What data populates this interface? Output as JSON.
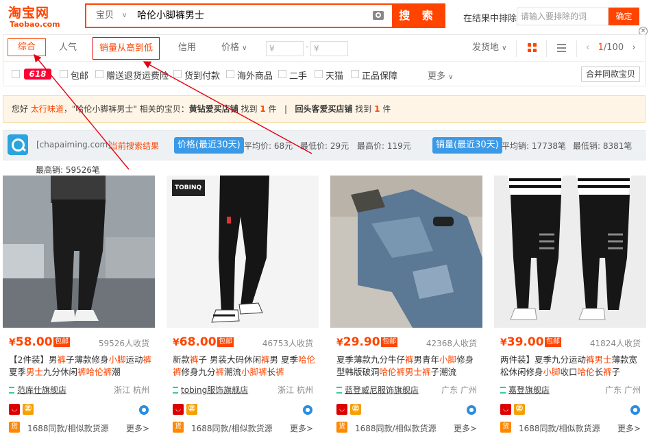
{
  "header": {
    "logo_line1": "淘宝网",
    "logo_line2": "Taobao.com",
    "search_type": "宝贝",
    "search_query": "哈伦小脚裤男士",
    "search_button": "搜 索",
    "exclude_label": "在结果中排除",
    "exclude_placeholder": "请输入要排除的词",
    "exclude_confirm": "确定"
  },
  "sortbar": {
    "items": [
      "综合",
      "人气",
      "销量从高到低",
      "信用",
      "价格"
    ],
    "price_from_placeholder": "¥",
    "price_to_placeholder": "¥",
    "price_dash": "-",
    "ship_from": "发货地",
    "page_current": "1",
    "page_total": "/100"
  },
  "filters": {
    "badge": "618",
    "items": [
      "包邮",
      "赠送退货运费险",
      "货到付款",
      "海外商品",
      "二手",
      "天猫",
      "正品保障"
    ],
    "more": "更多",
    "merge": "合并同款宝贝"
  },
  "notice": {
    "p1": "您好 ",
    "user": "太行味道",
    "p2": "，\"哈伦小脚裤男士\" 相关的宝贝：",
    "shop1": "黄钻爱买店铺",
    "p3": " 找到 ",
    "count1": "1",
    "p4": " 件   |   ",
    "shop2": "回头客爱买店铺",
    "p5": " 找到 ",
    "count2": "1",
    "p6": " 件"
  },
  "chapaiming": {
    "site": "[chapaiming.com]",
    "current": "当前搜索结果",
    "price_tag": "价格(最近30天)",
    "avg_price": "平均价: 68元",
    "min_price": "最低价: 29元",
    "max_price": "最高价: 119元",
    "sales_tag": "销量(最近30天)",
    "avg_sales": "平均销: 17738笔",
    "min_sales": "最低销: 8381笔",
    "max_sales": "最高销: 59526笔"
  },
  "products": [
    {
      "yen": "¥",
      "price": "58.00",
      "pinyou": "包邮",
      "paid": "59526人收货",
      "title_parts": [
        [
          "【2件装】男",
          ""
        ],
        [
          "裤",
          "h"
        ],
        [
          "子薄款修身",
          ""
        ],
        [
          "小脚",
          "h"
        ],
        [
          "运动",
          ""
        ],
        [
          "裤",
          "h"
        ],
        [
          "夏季",
          ""
        ],
        [
          "男士",
          "h"
        ],
        [
          "九分休闲",
          ""
        ],
        [
          "裤",
          "h"
        ],
        [
          "哈伦裤",
          "h"
        ],
        [
          "潮",
          ""
        ]
      ],
      "shop": "范库仕旗舰店",
      "loc": "浙江 杭州",
      "same": "1688同款/相似款货源",
      "more": "更多>"
    },
    {
      "yen": "¥",
      "price": "68.00",
      "pinyou": "包邮",
      "paid": "46753人收货",
      "title_parts": [
        [
          "新款",
          ""
        ],
        [
          "裤",
          "h"
        ],
        [
          "子 男装大码休闲",
          ""
        ],
        [
          "裤",
          "h"
        ],
        [
          "男 夏季",
          ""
        ],
        [
          "哈伦",
          "h"
        ],
        [
          "裤",
          "h"
        ],
        [
          "修身九分",
          ""
        ],
        [
          "裤",
          "h"
        ],
        [
          "潮流",
          ""
        ],
        [
          "小脚裤",
          "h"
        ],
        [
          "长",
          ""
        ],
        [
          "裤",
          "h"
        ]
      ],
      "shop": "tobing服饰旗舰店",
      "loc": "浙江 杭州",
      "same": "1688同款/相似款货源",
      "more": "更多>"
    },
    {
      "yen": "¥",
      "price": "29.90",
      "pinyou": "包邮",
      "paid": "42368人收货",
      "title_parts": [
        [
          "夏季薄款九分牛仔",
          ""
        ],
        [
          "裤",
          "h"
        ],
        [
          "男青年",
          ""
        ],
        [
          "小脚",
          "h"
        ],
        [
          "修身型韩版破洞",
          ""
        ],
        [
          "哈伦裤",
          "h"
        ],
        [
          "男士",
          "h"
        ],
        [
          "裤",
          "h"
        ],
        [
          "子潮流",
          ""
        ]
      ],
      "shop": "蓝登威尼服饰旗舰店",
      "loc": "广东 广州",
      "same": "1688同款/相似款货源",
      "more": "更多>"
    },
    {
      "yen": "¥",
      "price": "39.00",
      "pinyou": "包邮",
      "paid": "41824人收货",
      "title_parts": [
        [
          "两件装】夏季九分运动",
          ""
        ],
        [
          "裤",
          "h"
        ],
        [
          "男士",
          "h"
        ],
        [
          "薄款宽松休闲修身",
          ""
        ],
        [
          "小脚",
          "h"
        ],
        [
          "收口",
          ""
        ],
        [
          "哈伦",
          "h"
        ],
        [
          "长",
          ""
        ],
        [
          "裤",
          "h"
        ],
        [
          "子",
          ""
        ]
      ],
      "shop": "嘉登旗舰店",
      "loc": "广东 广州",
      "same": "1688同款/相似款货源",
      "more": "更多>"
    }
  ],
  "colors": {
    "accent": "#ff4400",
    "tag_blue": "#3b9ae8",
    "annotation": "#e60012"
  }
}
